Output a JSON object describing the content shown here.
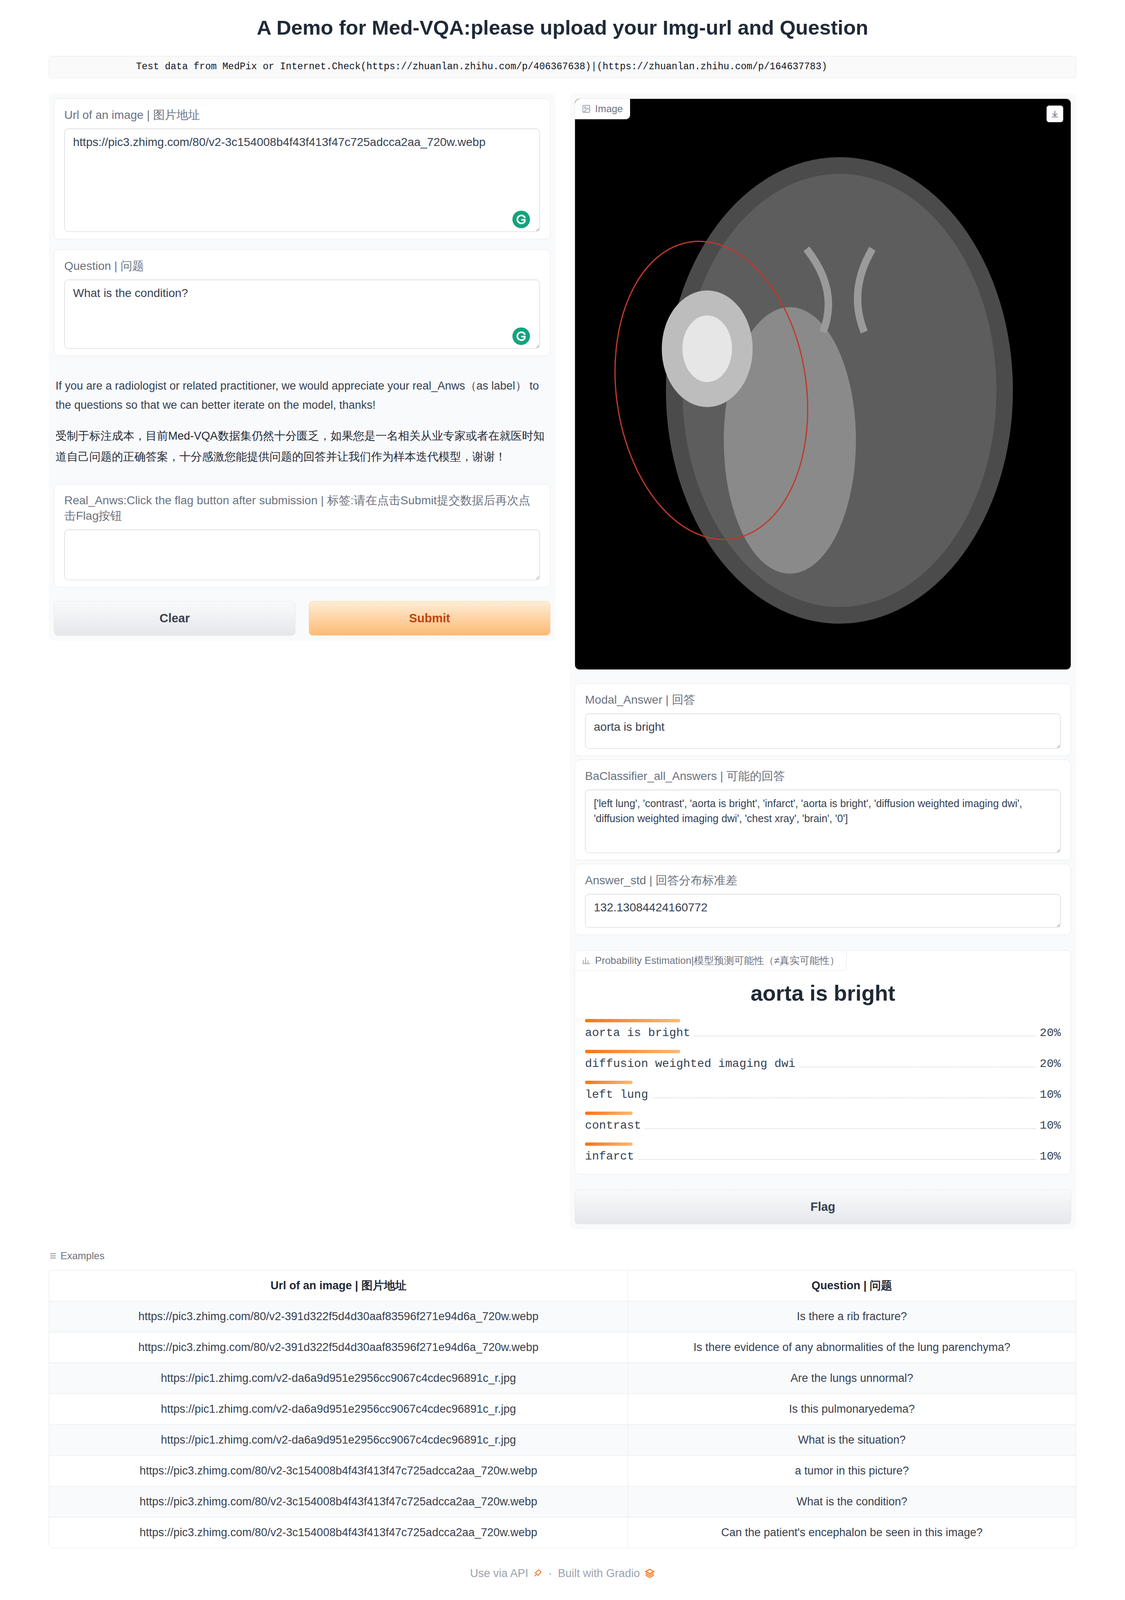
{
  "header": {
    "title": "A Demo for Med-VQA:please upload your Img-url and Question",
    "banner": "Test data from MedPix or Internet.Check(https://zhuanlan.zhihu.com/p/406367638)|(https://zhuanlan.zhihu.com/p/164637783)"
  },
  "inputs": {
    "url": {
      "label": "Url of an image | 图片地址",
      "value": "https://pic3.zhimg.com/80/v2-3c154008b4f43f413f47c725adcca2aa_720w.webp"
    },
    "question": {
      "label": "Question | 问题",
      "value": "What is the condition?"
    },
    "notes": [
      "If you are a radiologist or related practitioner, we would appreciate your real_Anws（as label） to the questions so that we can better iterate on the model, thanks!",
      "受制于标注成本，目前Med-VQA数据集仍然十分匮乏，如果您是一名相关从业专家或者在就医时知道自己问题的正确答案，十分感激您能提供问题的回答并让我们作为样本迭代模型，谢谢！"
    ],
    "real_answer": {
      "label": "Real_Anws:Click the flag button after submission | 标签:请在点击Submit提交数据后再次点击Flag按钮",
      "value": ""
    },
    "buttons": [
      {
        "label": "Clear",
        "kind": "secondary"
      },
      {
        "label": "Submit",
        "kind": "primary"
      }
    ]
  },
  "outputs": {
    "image": {
      "label": "Image"
    },
    "modal_answer": {
      "label": "Modal_Answer | 回答",
      "value": "aorta is bright"
    },
    "all_answers": {
      "label": "BaClassifier_all_Answers | 可能的回答",
      "value": "['left lung', 'contrast', 'aorta is bright', 'infarct', 'aorta is bright', 'diffusion weighted imaging dwi', 'diffusion weighted imaging dwi', 'chest xray', 'brain', '0']"
    },
    "answer_std": {
      "label": "Answer_std | 回答分布标准差",
      "value": "132.13084424160772"
    },
    "probability": {
      "label": "Probability Estimation|模型预测可能性（≠真实可能性）",
      "top": "aorta is bright",
      "rows": [
        {
          "label": "aorta is bright",
          "reading": "20%",
          "level": 0.2
        },
        {
          "label": "diffusion weighted imaging dwi",
          "reading": "20%",
          "level": 0.2
        },
        {
          "label": "left lung",
          "reading": "10%",
          "level": 0.1
        },
        {
          "label": "contrast",
          "reading": "10%",
          "level": 0.1
        },
        {
          "label": "infarct",
          "reading": "10%",
          "level": 0.1
        }
      ]
    },
    "flag": "Flag"
  },
  "examples": {
    "label": "Examples",
    "columns": [
      "Url of an image | 图片地址",
      "Question | 问题"
    ],
    "rows": [
      [
        "https://pic3.zhimg.com/80/v2-391d322f5d4d30aaf83596f271e94d6a_720w.webp",
        "Is there a rib fracture?"
      ],
      [
        "https://pic3.zhimg.com/80/v2-391d322f5d4d30aaf83596f271e94d6a_720w.webp",
        "Is there evidence of any abnormalities of the lung parenchyma?"
      ],
      [
        "https://pic1.zhimg.com/v2-da6a9d951e2956cc9067c4cdec96891c_r.jpg",
        "Are the lungs unnormal?"
      ],
      [
        "https://pic1.zhimg.com/v2-da6a9d951e2956cc9067c4cdec96891c_r.jpg",
        "Is this pulmonaryedema?"
      ],
      [
        "https://pic1.zhimg.com/v2-da6a9d951e2956cc9067c4cdec96891c_r.jpg",
        "What is the situation?"
      ],
      [
        "https://pic3.zhimg.com/80/v2-3c154008b4f43f413f47c725adcca2aa_720w.webp",
        "a tumor in this picture?"
      ],
      [
        "https://pic3.zhimg.com/80/v2-3c154008b4f43f413f47c725adcca2aa_720w.webp",
        "What is the condition?"
      ],
      [
        "https://pic3.zhimg.com/80/v2-3c154008b4f43f413f47c725adcca2aa_720w.webp",
        "Can the patient's encephalon be seen in this image?"
      ]
    ]
  },
  "footer": {
    "links": [
      "Use via API",
      "Built with Gradio"
    ],
    "separator": "·"
  }
}
